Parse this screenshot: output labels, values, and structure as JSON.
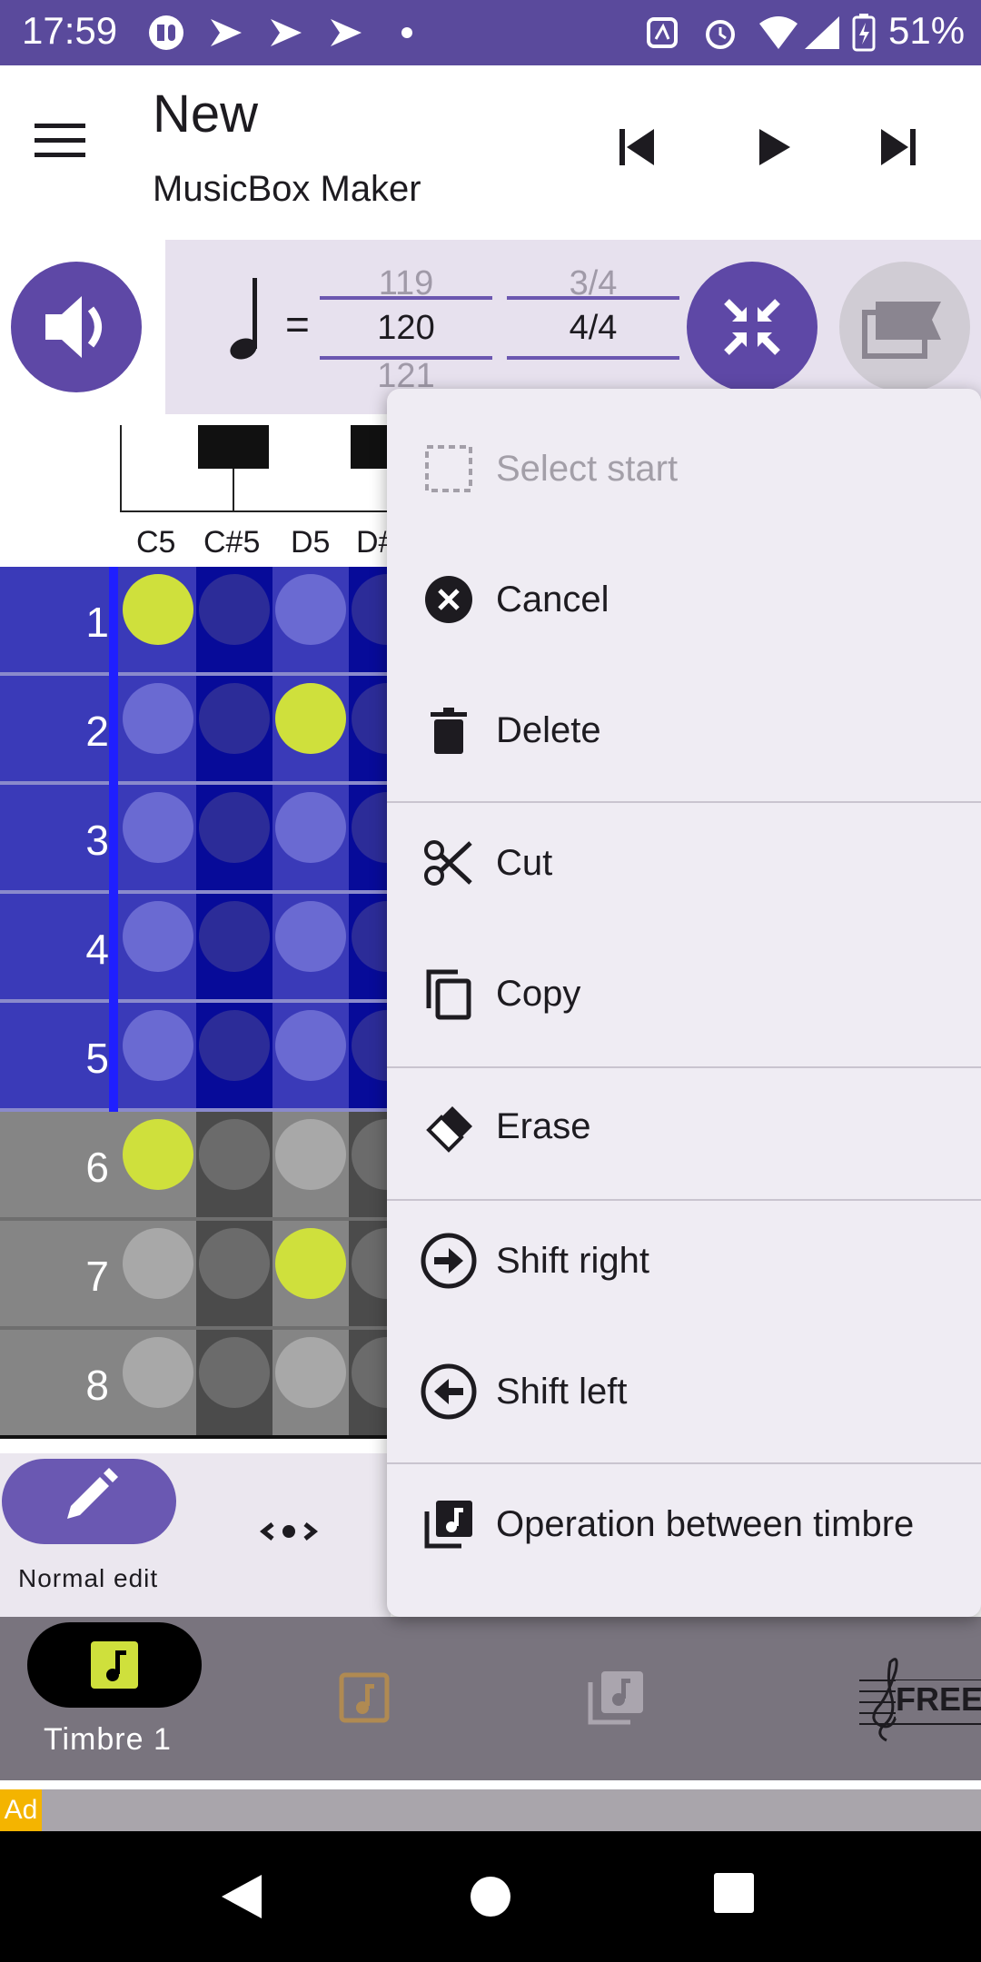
{
  "status_bar": {
    "time": "17:59",
    "battery": "51%",
    "left_icons": [
      "app-icon",
      "play-store-icon",
      "play-store-icon",
      "play-store-icon",
      "dot-icon"
    ],
    "right_icons": [
      "nfc-icon",
      "alarm-icon",
      "wifi-icon",
      "signal-icon",
      "battery-charging-icon"
    ]
  },
  "app_bar": {
    "title": "New",
    "subtitle": "MusicBox Maker"
  },
  "tempo": {
    "bpm_prev": "119",
    "bpm": "120",
    "bpm_next": "121",
    "sig_prev": "3/4",
    "sig": "4/4",
    "equals": "="
  },
  "keyboard": {
    "labels": [
      "C5",
      "C#5",
      "D5",
      "D#"
    ]
  },
  "grid": {
    "rows": [
      "1",
      "2",
      "3",
      "4",
      "5",
      "6",
      "7",
      "8"
    ]
  },
  "edit_bar": {
    "mode_label": "Normal edit"
  },
  "bottom_nav": {
    "timbre_label": "Timbre 1",
    "free_label": "FREE"
  },
  "ad": {
    "tag": "Ad"
  },
  "menu": {
    "items": [
      {
        "label": "Select start",
        "icon": "select-dashed-icon",
        "disabled": true
      },
      {
        "label": "Cancel",
        "icon": "cancel-icon"
      },
      {
        "label": "Delete",
        "icon": "trash-icon"
      },
      {
        "label": "Cut",
        "icon": "scissors-icon"
      },
      {
        "label": "Copy",
        "icon": "copy-icon"
      },
      {
        "label": "Erase",
        "icon": "eraser-icon"
      },
      {
        "label": "Shift right",
        "icon": "arrow-right-circle-icon"
      },
      {
        "label": "Shift left",
        "icon": "arrow-left-circle-icon"
      },
      {
        "label": "Operation between timbre",
        "icon": "music-library-icon"
      }
    ]
  },
  "colors": {
    "primary": "#5e48a6",
    "status_bar": "#5a4a9c",
    "active_note": "#cfe03c",
    "active_column": "#3a3ab8",
    "inactive_column": "#858585"
  }
}
